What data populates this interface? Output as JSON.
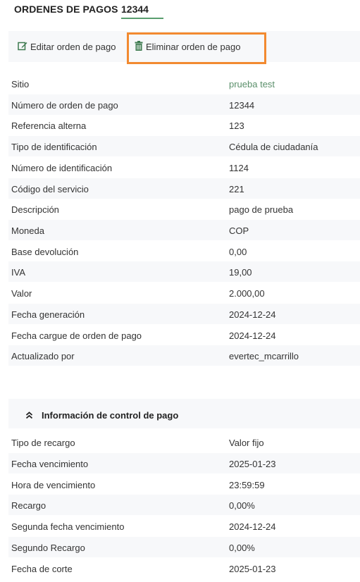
{
  "header": {
    "title": "ORDENES DE PAGOS",
    "order_number": "12344"
  },
  "toolbar": {
    "edit_label": "Editar orden de pago",
    "delete_label": "Eliminar orden de pago"
  },
  "details": [
    {
      "label": "Sitio",
      "value": "prueba test"
    },
    {
      "label": "Número de orden de pago",
      "value": "12344"
    },
    {
      "label": "Referencia alterna",
      "value": "123"
    },
    {
      "label": "Tipo de identificación",
      "value": "Cédula de ciudadanía"
    },
    {
      "label": "Número de identificación",
      "value": "1124"
    },
    {
      "label": "Código del servicio",
      "value": "221"
    },
    {
      "label": "Descripción",
      "value": "pago de prueba"
    },
    {
      "label": "Moneda",
      "value": "COP"
    },
    {
      "label": "Base devolución",
      "value": "0,00"
    },
    {
      "label": "IVA",
      "value": "19,00"
    },
    {
      "label": "Valor",
      "value": "2.000,00"
    },
    {
      "label": "Fecha generación",
      "value": "2024-12-24"
    },
    {
      "label": "Fecha cargue de orden de pago",
      "value": "2024-12-24"
    },
    {
      "label": "Actualizado por",
      "value": "evertec_mcarrillo"
    }
  ],
  "control_section": {
    "title": "Información de control de pago",
    "rows": [
      {
        "label": "Tipo de recargo",
        "value": "Valor fijo"
      },
      {
        "label": "Fecha vencimiento",
        "value": "2025-01-23"
      },
      {
        "label": "Hora de vencimiento",
        "value": "23:59:59"
      },
      {
        "label": "Recargo",
        "value": "0,00%"
      },
      {
        "label": "Segunda fecha vencimiento",
        "value": "2024-12-24"
      },
      {
        "label": "Segundo Recargo",
        "value": "0,00%"
      },
      {
        "label": "Fecha de corte",
        "value": "2025-01-23"
      }
    ]
  },
  "colors": {
    "accent": "#5a9e6f",
    "highlight": "#f28a30",
    "stripe": "#f7f8fa"
  }
}
